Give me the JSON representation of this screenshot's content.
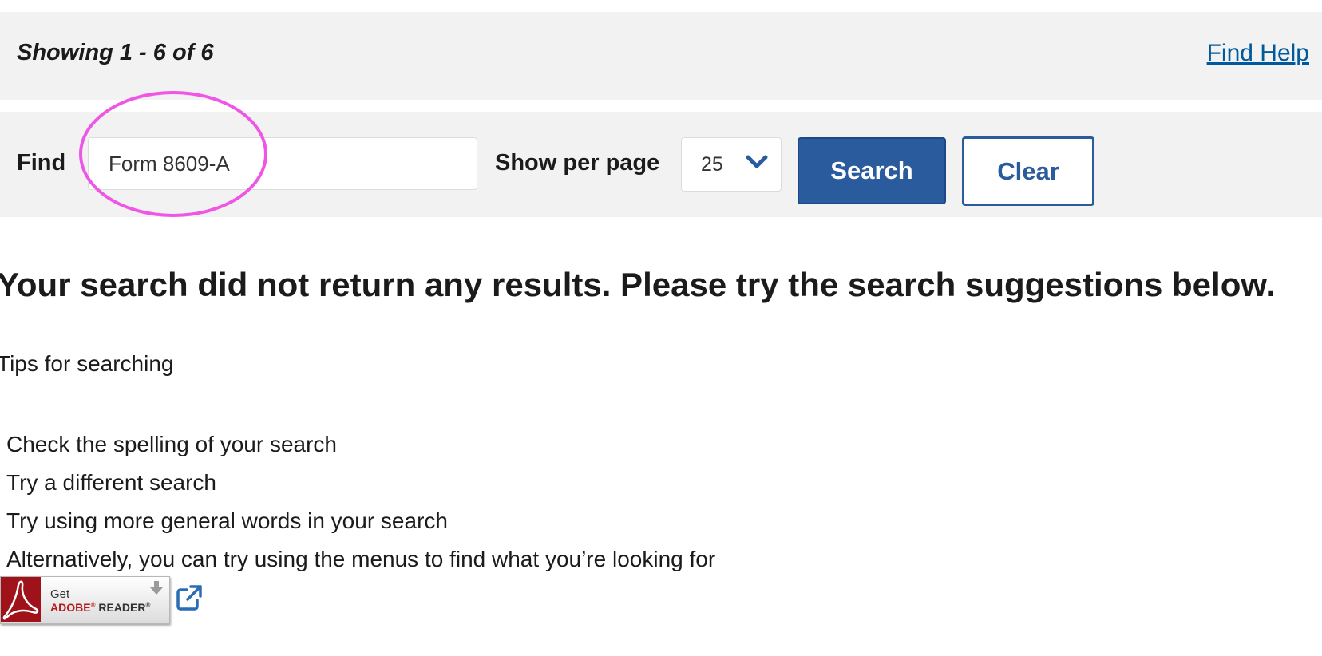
{
  "results_bar": {
    "showing_text": "Showing 1 - 6 of 6",
    "find_help_link": "Find Help"
  },
  "search_form": {
    "find_label": "Find",
    "find_value": "Form 8609-A",
    "per_page_label": "Show per page",
    "per_page_selected": "25",
    "search_button": "Search",
    "clear_button": "Clear"
  },
  "message": {
    "no_results": "Your search did not return any results. Please try the search suggestions below.",
    "tips_heading": "Tips for searching",
    "tips": [
      "Check the spelling of your search",
      "Try a different search",
      "Try using more general words in your search",
      "Alternatively, you can try using the menus to find what you’re looking for"
    ]
  },
  "adobe_badge": {
    "get": "Get",
    "brand": "ADOBE",
    "product": "READER"
  },
  "colors": {
    "link": "#00599c",
    "primary_button": "#2a5b9d",
    "highlight_ring": "#f056e6",
    "panel_background": "#f2f2f2",
    "adobe_red": "#a0121a"
  },
  "icons": [
    "chevron-down-icon",
    "download-arrow-icon",
    "external-link-icon",
    "adobe-pdf-icon"
  ]
}
